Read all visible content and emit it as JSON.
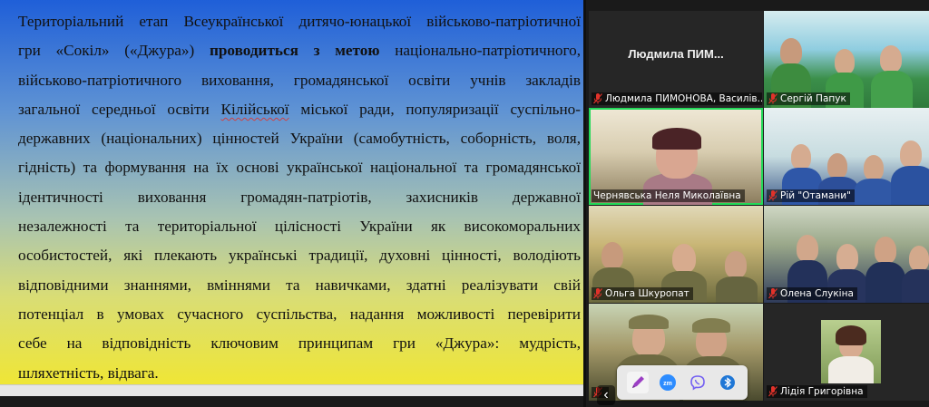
{
  "slide": {
    "lines": [
      [
        "Територіальний етап Всеукраїнської дитячо-юнацької військово-патріотичної"
      ],
      [
        "гри «Сокіл» («Джура») ",
        "проводиться з метою",
        " національно-патріотичного,"
      ],
      [
        "військово-патріотичного виховання, громадянської освіти учнів закладів"
      ],
      [
        "загальної середньої освіти ",
        "Кілійської",
        " міської ради, популяризації суспільно-"
      ],
      [
        "державних (національних) цінностей України (самобутність, соборність, воля,"
      ],
      [
        "гідність) та формування на їх основі української національної та громадянської"
      ],
      [
        "ідентичності виховання громадян-патріотів, захисників державної"
      ],
      [
        "незалежності та територіальної цілісності України як високоморальних"
      ],
      [
        "особистостей, які плекають українські традиції, духовні цінності, володіють"
      ],
      [
        "відповідними знаннями, вміннями та навичками, здатні реалізувати свій"
      ],
      [
        "потенціал в умовах сучасного суспільства, надання можливості  перевірити"
      ],
      [
        "себе на відповідність ключовим принципам гри «Джура»: мудрість,"
      ],
      [
        "шляхетність, відвага."
      ]
    ]
  },
  "participants": [
    {
      "tile_title": "Людмила  ПИМ...",
      "name": "Людмила ПИМОНОВА, Василів...",
      "muted": true
    },
    {
      "name": "Сергій Папук",
      "muted": true
    },
    {
      "name": "Чернявська Неля Миколаївна",
      "muted": false,
      "active": true
    },
    {
      "name": "Рій \"Отамани\"",
      "muted": true
    },
    {
      "name": "Ольга Шкуропат",
      "muted": true
    },
    {
      "name": "Олена Слукіна",
      "muted": true
    },
    {
      "name": "",
      "muted": true
    },
    {
      "name": "Лідія Григорівна",
      "muted": true
    }
  ],
  "toolbar": {
    "buttons": [
      "pen-icon",
      "zoom-icon",
      "viber-icon",
      "bluetooth-icon"
    ],
    "zoom_label": "zm"
  },
  "colors": {
    "active_speaker": "#23d959",
    "muted_mic": "#e0322a"
  }
}
